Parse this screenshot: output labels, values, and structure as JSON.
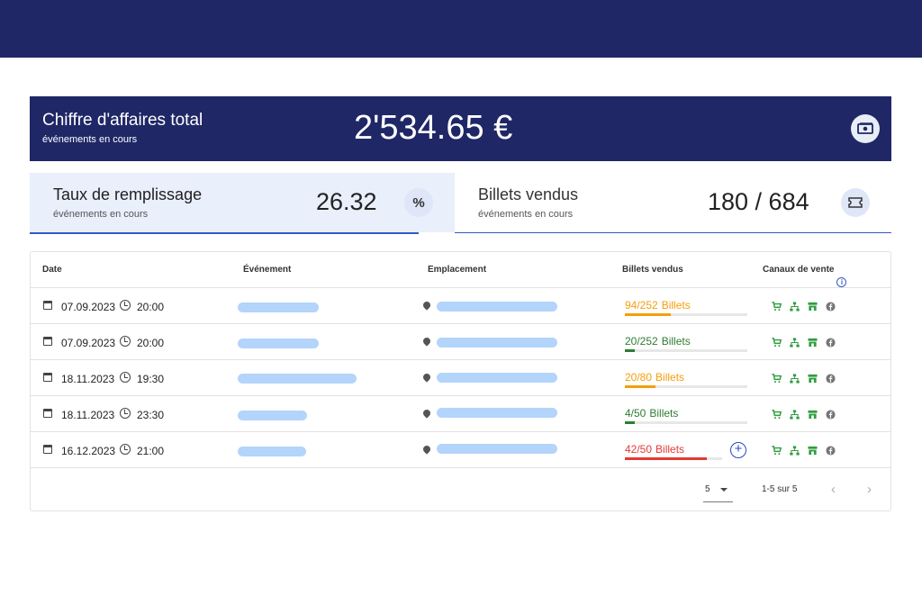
{
  "revenue": {
    "title": "Chiffre d'affaires total",
    "subtitle": "événements en cours",
    "value": "2'534.65 €",
    "icon": "money-icon"
  },
  "occupancy": {
    "title": "Taux de remplissage",
    "subtitle": "événements en cours",
    "value": "26.32",
    "icon": "percent-icon",
    "icon_glyph": "%"
  },
  "tickets_sold": {
    "title": "Billets vendus",
    "subtitle": "événements en cours",
    "value": "180 / 684",
    "icon": "ticket-icon"
  },
  "table": {
    "headers": {
      "date": "Date",
      "event": "Événement",
      "location": "Emplacement",
      "tickets": "Billets vendus",
      "channels": "Canaux de vente"
    },
    "rows": [
      {
        "date": "07.09.2023",
        "time": "20:00",
        "count": "94/252",
        "label": "Billets",
        "sold": 94,
        "capacity": 252,
        "color": "#f59e0b"
      },
      {
        "date": "07.09.2023",
        "time": "20:00",
        "count": "20/252",
        "label": "Billets",
        "sold": 20,
        "capacity": 252,
        "color": "#2e7d32"
      },
      {
        "date": "18.11.2023",
        "time": "19:30",
        "count": "20/80",
        "label": "Billets",
        "sold": 20,
        "capacity": 80,
        "color": "#f59e0b"
      },
      {
        "date": "18.11.2023",
        "time": "23:30",
        "count": "4/50",
        "label": "Billets",
        "sold": 4,
        "capacity": 50,
        "color": "#2e7d32"
      },
      {
        "date": "16.12.2023",
        "time": "21:00",
        "count": "42/50",
        "label": "Billets",
        "sold": 42,
        "capacity": 50,
        "color": "#e53935"
      }
    ],
    "channel_icons": [
      "cart-icon",
      "network-icon",
      "store-icon",
      "facebook-icon"
    ],
    "channel_color": "#2e9e3e"
  },
  "pagination": {
    "per_page": "5",
    "range": "1-5 sur 5"
  },
  "colors": {
    "navy": "#1f2766",
    "accent": "#3557c9"
  }
}
